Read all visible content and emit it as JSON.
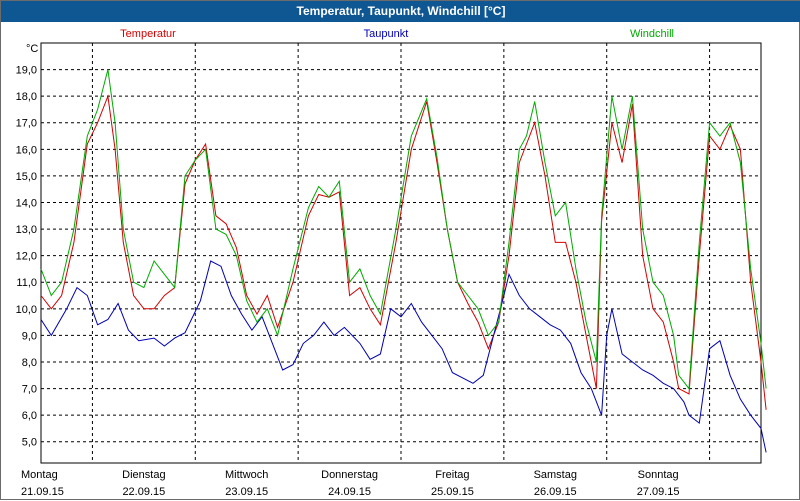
{
  "window": {
    "title": "Temperatur, Taupunkt, Windchill [°C]"
  },
  "chart_data": {
    "type": "line",
    "title": "Temperatur, Taupunkt, Windchill [°C]",
    "ylabel": "°C",
    "ylim": [
      4.2,
      20.0
    ],
    "yticks": [
      "5,0",
      "6,0",
      "7,0",
      "8,0",
      "9,0",
      "10,0",
      "11,0",
      "12,0",
      "13,0",
      "14,0",
      "15,0",
      "16,0",
      "17,0",
      "18,0",
      "19,0"
    ],
    "x_days": [
      {
        "weekday": "Montag",
        "date": "21.09.15"
      },
      {
        "weekday": "Dienstag",
        "date": "22.09.15"
      },
      {
        "weekday": "Mittwoch",
        "date": "23.09.15"
      },
      {
        "weekday": "Donnerstag",
        "date": "24.09.15"
      },
      {
        "weekday": "Freitag",
        "date": "25.09.15"
      },
      {
        "weekday": "Samstag",
        "date": "26.09.15"
      },
      {
        "weekday": "Sonntag",
        "date": "27.09.15"
      }
    ],
    "grid": true,
    "series": [
      {
        "name": "Temperatur",
        "color": "#d40000",
        "points": [
          [
            0,
            10.5
          ],
          [
            0.1,
            10.0
          ],
          [
            0.2,
            10.5
          ],
          [
            0.32,
            12.5
          ],
          [
            0.45,
            16.2
          ],
          [
            0.55,
            17.0
          ],
          [
            0.65,
            18.0
          ],
          [
            0.72,
            16.0
          ],
          [
            0.8,
            12.5
          ],
          [
            0.9,
            10.5
          ],
          [
            1.0,
            10.0
          ],
          [
            1.1,
            10.0
          ],
          [
            1.2,
            10.5
          ],
          [
            1.3,
            10.8
          ],
          [
            1.4,
            14.7
          ],
          [
            1.5,
            15.6
          ],
          [
            1.6,
            16.2
          ],
          [
            1.7,
            13.5
          ],
          [
            1.8,
            13.2
          ],
          [
            1.9,
            12.3
          ],
          [
            2.0,
            10.5
          ],
          [
            2.1,
            9.8
          ],
          [
            2.2,
            10.5
          ],
          [
            2.3,
            9.3
          ],
          [
            2.45,
            11.0
          ],
          [
            2.6,
            13.5
          ],
          [
            2.7,
            14.3
          ],
          [
            2.8,
            14.2
          ],
          [
            2.9,
            14.4
          ],
          [
            3.0,
            10.5
          ],
          [
            3.1,
            10.8
          ],
          [
            3.2,
            10.0
          ],
          [
            3.3,
            9.4
          ],
          [
            3.45,
            12.5
          ],
          [
            3.6,
            16.0
          ],
          [
            3.75,
            17.8
          ],
          [
            3.85,
            15.5
          ],
          [
            3.95,
            13.0
          ],
          [
            4.05,
            11.0
          ],
          [
            4.15,
            10.2
          ],
          [
            4.25,
            9.5
          ],
          [
            4.35,
            8.5
          ],
          [
            4.45,
            9.5
          ],
          [
            4.55,
            12.0
          ],
          [
            4.65,
            15.5
          ],
          [
            4.72,
            16.2
          ],
          [
            4.8,
            17.0
          ],
          [
            4.9,
            15.0
          ],
          [
            5.0,
            12.5
          ],
          [
            5.1,
            12.5
          ],
          [
            5.2,
            11.0
          ],
          [
            5.3,
            9.0
          ],
          [
            5.4,
            7.0
          ],
          [
            5.45,
            13.3
          ],
          [
            5.55,
            17.0
          ],
          [
            5.65,
            15.5
          ],
          [
            5.75,
            17.7
          ],
          [
            5.85,
            12.0
          ],
          [
            5.95,
            10.0
          ],
          [
            6.05,
            9.5
          ],
          [
            6.15,
            8.0
          ],
          [
            6.2,
            7.0
          ],
          [
            6.3,
            6.8
          ],
          [
            6.4,
            12.0
          ],
          [
            6.5,
            16.5
          ],
          [
            6.6,
            16.0
          ],
          [
            6.7,
            16.9
          ],
          [
            6.8,
            16.0
          ],
          [
            6.9,
            11.0
          ],
          [
            7.0,
            8.0
          ],
          [
            7.05,
            6.2
          ]
        ]
      },
      {
        "name": "Taupunkt",
        "color": "#0000b4",
        "points": [
          [
            0,
            9.6
          ],
          [
            0.1,
            9.0
          ],
          [
            0.25,
            10.0
          ],
          [
            0.35,
            10.8
          ],
          [
            0.45,
            10.5
          ],
          [
            0.55,
            9.4
          ],
          [
            0.65,
            9.6
          ],
          [
            0.75,
            10.2
          ],
          [
            0.85,
            9.2
          ],
          [
            0.95,
            8.8
          ],
          [
            1.1,
            8.9
          ],
          [
            1.2,
            8.6
          ],
          [
            1.3,
            8.9
          ],
          [
            1.4,
            9.1
          ],
          [
            1.55,
            10.3
          ],
          [
            1.65,
            11.8
          ],
          [
            1.75,
            11.6
          ],
          [
            1.85,
            10.5
          ],
          [
            1.95,
            9.8
          ],
          [
            2.05,
            9.2
          ],
          [
            2.15,
            9.7
          ],
          [
            2.25,
            8.7
          ],
          [
            2.35,
            7.7
          ],
          [
            2.45,
            7.9
          ],
          [
            2.55,
            8.7
          ],
          [
            2.65,
            9.0
          ],
          [
            2.75,
            9.5
          ],
          [
            2.85,
            9.0
          ],
          [
            2.95,
            9.3
          ],
          [
            3.1,
            8.7
          ],
          [
            3.2,
            8.1
          ],
          [
            3.3,
            8.3
          ],
          [
            3.4,
            10.0
          ],
          [
            3.5,
            9.7
          ],
          [
            3.6,
            10.2
          ],
          [
            3.7,
            9.5
          ],
          [
            3.8,
            9.0
          ],
          [
            3.9,
            8.5
          ],
          [
            4.0,
            7.6
          ],
          [
            4.1,
            7.4
          ],
          [
            4.2,
            7.2
          ],
          [
            4.3,
            7.5
          ],
          [
            4.4,
            9.0
          ],
          [
            4.5,
            10.5
          ],
          [
            4.55,
            11.3
          ],
          [
            4.65,
            10.5
          ],
          [
            4.75,
            10.0
          ],
          [
            4.85,
            9.7
          ],
          [
            4.95,
            9.4
          ],
          [
            5.05,
            9.2
          ],
          [
            5.15,
            8.7
          ],
          [
            5.25,
            7.6
          ],
          [
            5.35,
            7.0
          ],
          [
            5.45,
            6.0
          ],
          [
            5.5,
            9.0
          ],
          [
            5.55,
            10.0
          ],
          [
            5.65,
            8.3
          ],
          [
            5.75,
            8.0
          ],
          [
            5.85,
            7.7
          ],
          [
            5.95,
            7.5
          ],
          [
            6.05,
            7.2
          ],
          [
            6.15,
            7.0
          ],
          [
            6.25,
            6.5
          ],
          [
            6.3,
            6.0
          ],
          [
            6.4,
            5.7
          ],
          [
            6.5,
            8.5
          ],
          [
            6.6,
            8.8
          ],
          [
            6.7,
            7.5
          ],
          [
            6.8,
            6.6
          ],
          [
            6.9,
            6.0
          ],
          [
            7.0,
            5.5
          ],
          [
            7.05,
            4.6
          ]
        ]
      },
      {
        "name": "Windchill",
        "color": "#00aa00",
        "points": [
          [
            0,
            11.5
          ],
          [
            0.1,
            10.5
          ],
          [
            0.2,
            11.0
          ],
          [
            0.32,
            13.0
          ],
          [
            0.45,
            16.5
          ],
          [
            0.55,
            17.5
          ],
          [
            0.65,
            19.0
          ],
          [
            0.72,
            17.0
          ],
          [
            0.8,
            13.0
          ],
          [
            0.9,
            11.0
          ],
          [
            1.0,
            10.8
          ],
          [
            1.1,
            11.8
          ],
          [
            1.2,
            11.3
          ],
          [
            1.3,
            10.8
          ],
          [
            1.4,
            15.0
          ],
          [
            1.5,
            15.6
          ],
          [
            1.6,
            16.0
          ],
          [
            1.7,
            13.0
          ],
          [
            1.8,
            12.8
          ],
          [
            1.9,
            12.0
          ],
          [
            2.0,
            10.3
          ],
          [
            2.1,
            9.5
          ],
          [
            2.2,
            10.0
          ],
          [
            2.3,
            9.0
          ],
          [
            2.45,
            11.5
          ],
          [
            2.6,
            13.8
          ],
          [
            2.7,
            14.6
          ],
          [
            2.8,
            14.2
          ],
          [
            2.9,
            14.8
          ],
          [
            3.0,
            11.0
          ],
          [
            3.1,
            11.5
          ],
          [
            3.2,
            10.5
          ],
          [
            3.3,
            9.8
          ],
          [
            3.45,
            13.0
          ],
          [
            3.6,
            16.5
          ],
          [
            3.75,
            17.9
          ],
          [
            3.85,
            15.7
          ],
          [
            3.95,
            13.0
          ],
          [
            4.05,
            11.0
          ],
          [
            4.15,
            10.5
          ],
          [
            4.25,
            10.0
          ],
          [
            4.35,
            9.0
          ],
          [
            4.45,
            9.5
          ],
          [
            4.55,
            12.5
          ],
          [
            4.65,
            16.0
          ],
          [
            4.72,
            16.5
          ],
          [
            4.8,
            17.8
          ],
          [
            4.9,
            15.5
          ],
          [
            5.0,
            13.5
          ],
          [
            5.1,
            14.0
          ],
          [
            5.2,
            11.5
          ],
          [
            5.3,
            9.5
          ],
          [
            5.4,
            8.0
          ],
          [
            5.45,
            13.5
          ],
          [
            5.55,
            18.0
          ],
          [
            5.65,
            16.0
          ],
          [
            5.75,
            18.0
          ],
          [
            5.85,
            13.0
          ],
          [
            5.95,
            11.0
          ],
          [
            6.05,
            10.5
          ],
          [
            6.15,
            9.0
          ],
          [
            6.2,
            7.5
          ],
          [
            6.3,
            7.0
          ],
          [
            6.4,
            12.5
          ],
          [
            6.5,
            17.0
          ],
          [
            6.6,
            16.5
          ],
          [
            6.7,
            17.0
          ],
          [
            6.8,
            15.5
          ],
          [
            6.9,
            11.5
          ],
          [
            7.0,
            8.7
          ],
          [
            7.05,
            7.0
          ]
        ]
      }
    ]
  }
}
